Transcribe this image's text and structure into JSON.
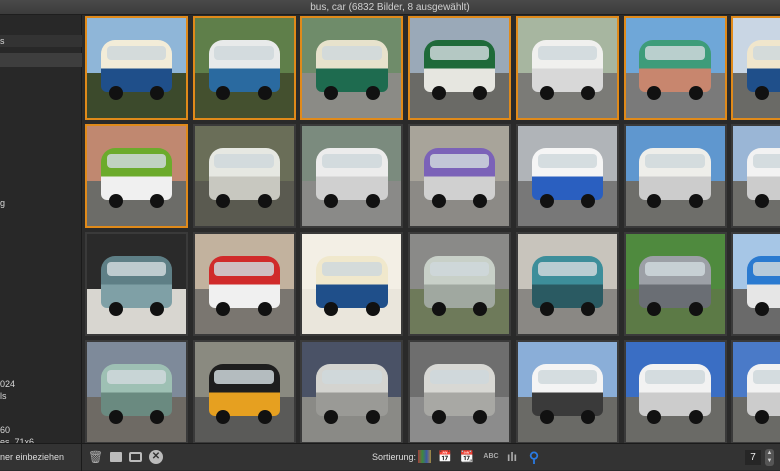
{
  "window": {
    "title": "bus, car (6832 Bilder, 8 ausgewählt)"
  },
  "sidebar": {
    "items": [
      {
        "label": "s"
      },
      {
        "label": ""
      },
      {
        "label": "g"
      },
      {
        "label": "024"
      },
      {
        "label": "ls"
      },
      {
        "label": "60"
      },
      {
        "label": "es_71x6"
      }
    ],
    "footer_label": "ner einbeziehen"
  },
  "grid": {
    "selected_count": 8,
    "selection_color": "#e08a1a",
    "tiles": [
      {
        "selected": true,
        "sky": "#8fb6d8",
        "ground": "#3c4a2c",
        "body": "#f2ecd8",
        "accent": "#1f4f8a"
      },
      {
        "selected": true,
        "sky": "#5f7f4a",
        "ground": "#44502f",
        "body": "#e8eaea",
        "accent": "#2a6aa0"
      },
      {
        "selected": true,
        "sky": "#6f8c6a",
        "ground": "#8b8b86",
        "body": "#e7e2cc",
        "accent": "#1e6b4f"
      },
      {
        "selected": true,
        "sky": "#9aa9b8",
        "ground": "#6a6a66",
        "body": "#1f6a3a",
        "accent": "#e6e6e0"
      },
      {
        "selected": true,
        "sky": "#a7b6a0",
        "ground": "#7b7b77",
        "body": "#f0f0ee",
        "accent": "#d8d8d8"
      },
      {
        "selected": true,
        "sky": "#6fa7d8",
        "ground": "#7a7a7a",
        "body": "#3e9c7a",
        "accent": "#c8866e"
      },
      {
        "selected": true,
        "sky": "#c9d6e4",
        "ground": "#6a6a66",
        "body": "#f0e6cc",
        "accent": "#1f4f8a"
      },
      {
        "selected": true,
        "sky": "#c08870",
        "ground": "#6c6c68",
        "body": "#6cab2c",
        "accent": "#f0f0f0"
      },
      {
        "selected": false,
        "sky": "#6a6e58",
        "ground": "#5a5a50",
        "body": "#e6e8e2",
        "accent": "#c8c8c0"
      },
      {
        "selected": false,
        "sky": "#7b8b7e",
        "ground": "#8a8a88",
        "body": "#ececec",
        "accent": "#d0d0d0"
      },
      {
        "selected": false,
        "sky": "#a8a49a",
        "ground": "#8c8a86",
        "body": "#7b62b8",
        "accent": "#d0d0d0"
      },
      {
        "selected": false,
        "sky": "#b0b4b8",
        "ground": "#787878",
        "body": "#f5f5f5",
        "accent": "#2a5fc0"
      },
      {
        "selected": false,
        "sky": "#5f97cf",
        "ground": "#6e6e6a",
        "body": "#eeeeea",
        "accent": "#cccccc"
      },
      {
        "selected": false,
        "sky": "#9ab6d6",
        "ground": "#6e6e6a",
        "body": "#f2f2f2",
        "accent": "#cccccc"
      },
      {
        "selected": false,
        "sky": "#2a2a2a",
        "ground": "#d8d6d0",
        "body": "#5e7f86",
        "accent": "#7fa0a6"
      },
      {
        "selected": false,
        "sky": "#c2b29e",
        "ground": "#7a7670",
        "body": "#d02a2a",
        "accent": "#f0f0f0"
      },
      {
        "selected": false,
        "sky": "#f3efe5",
        "ground": "#eae6dc",
        "body": "#f0e8cc",
        "accent": "#1f4f8a"
      },
      {
        "selected": false,
        "sky": "#8a8a88",
        "ground": "#6e7a5a",
        "body": "#c8d0c8",
        "accent": "#a0a8a0"
      },
      {
        "selected": false,
        "sky": "#c8c4bc",
        "ground": "#8a8884",
        "body": "#3d8e9a",
        "accent": "#2a5a62"
      },
      {
        "selected": false,
        "sky": "#4f8a3e",
        "ground": "#5c7a46",
        "body": "#9ca0a6",
        "accent": "#6a6e74"
      },
      {
        "selected": false,
        "sky": "#a6c6e6",
        "ground": "#6a6a6a",
        "body": "#2a7ad0",
        "accent": "#e6e6e6"
      },
      {
        "selected": false,
        "sky": "#7e8a9a",
        "ground": "#6e6a64",
        "body": "#9ec0b4",
        "accent": "#6a8a80"
      },
      {
        "selected": false,
        "sky": "#8a8a80",
        "ground": "#5a5a58",
        "body": "#1e1e1e",
        "accent": "#e6a020"
      },
      {
        "selected": false,
        "sky": "#4a5266",
        "ground": "#8a8a86",
        "body": "#d4d4d0",
        "accent": "#9a9a96"
      },
      {
        "selected": false,
        "sky": "#6e6e6e",
        "ground": "#8c8c8c",
        "body": "#d8d8d4",
        "accent": "#a8a8a4"
      },
      {
        "selected": false,
        "sky": "#8aaed8",
        "ground": "#6a6a66",
        "body": "#f4f4f4",
        "accent": "#3a3a3a"
      },
      {
        "selected": false,
        "sky": "#3a6ec4",
        "ground": "#6a6a66",
        "body": "#f2f2f2",
        "accent": "#cccccc"
      },
      {
        "selected": false,
        "sky": "#4a7ac8",
        "ground": "#6a6a66",
        "body": "#f2f2f2",
        "accent": "#cccccc"
      }
    ]
  },
  "bottombar": {
    "sort_label": "Sortierung:",
    "sort_text_label": "ABC",
    "columns_value": "7",
    "active_color": "#2a7ae2"
  }
}
